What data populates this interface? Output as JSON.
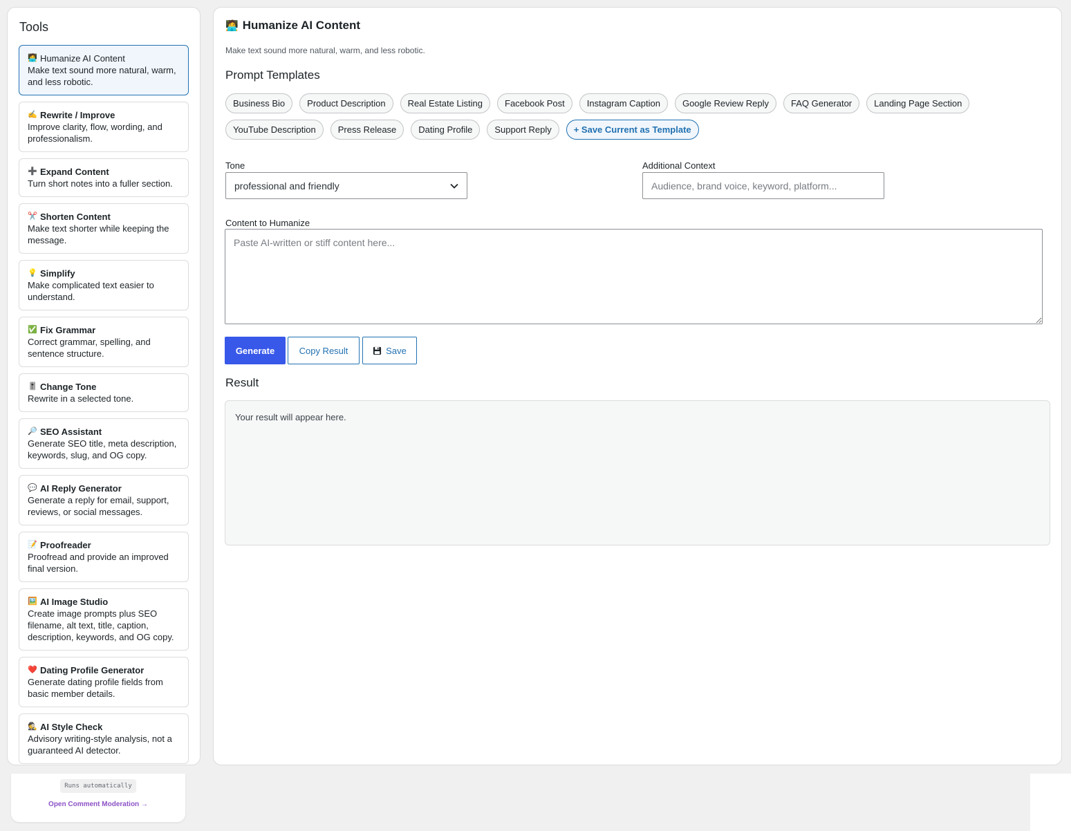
{
  "sidebar": {
    "title": "Tools",
    "tools": [
      {
        "icon": "🧑‍💻",
        "name": "Humanize AI Content",
        "desc": "Make text sound more natural, warm, and less robotic."
      },
      {
        "icon": "✍️",
        "name": "Rewrite / Improve",
        "desc": "Improve clarity, flow, wording, and professionalism."
      },
      {
        "icon": "➕",
        "name": "Expand Content",
        "desc": "Turn short notes into a fuller section."
      },
      {
        "icon": "✂️",
        "name": "Shorten Content",
        "desc": "Make text shorter while keeping the message."
      },
      {
        "icon": "💡",
        "name": "Simplify",
        "desc": "Make complicated text easier to understand."
      },
      {
        "icon": "✅",
        "name": "Fix Grammar",
        "desc": "Correct grammar, spelling, and sentence structure."
      },
      {
        "icon": "🎚️",
        "name": "Change Tone",
        "desc": "Rewrite in a selected tone."
      },
      {
        "icon": "🔎",
        "name": "SEO Assistant",
        "desc": "Generate SEO title, meta description, keywords, slug, and OG copy."
      },
      {
        "icon": "💬",
        "name": "AI Reply Generator",
        "desc": "Generate a reply for email, support, reviews, or social messages."
      },
      {
        "icon": "📝",
        "name": "Proofreader",
        "desc": "Proofread and provide an improved final version."
      },
      {
        "icon": "🖼️",
        "name": "AI Image Studio",
        "desc": "Create image prompts plus SEO filename, alt text, title, caption, description, keywords, and OG copy."
      },
      {
        "icon": "❤️",
        "name": "Dating Profile Generator",
        "desc": "Generate dating profile fields from basic member details."
      },
      {
        "icon": "🕵️",
        "name": "AI Style Check",
        "desc": "Advisory writing-style analysis, not a guaranteed AI detector."
      }
    ]
  },
  "mini_card": {
    "badge": "Runs automatically",
    "link": "Open Comment Moderation →"
  },
  "main": {
    "title_icon": "🧑‍💻",
    "title": "Humanize AI Content",
    "subtitle": "Make text sound more natural, warm, and less robotic.",
    "templates_heading": "Prompt Templates",
    "templates": [
      "Business Bio",
      "Product Description",
      "Real Estate Listing",
      "Facebook Post",
      "Instagram Caption",
      "Google Review Reply",
      "FAQ Generator",
      "Landing Page Section",
      "YouTube Description",
      "Press Release",
      "Dating Profile",
      "Support Reply"
    ],
    "save_template_label": "+ Save Current as Template",
    "tone_label": "Tone",
    "tone_value": "professional and friendly",
    "context_label": "Additional Context",
    "context_placeholder": "Audience, brand voice, keyword, platform...",
    "content_label": "Content to Humanize",
    "content_placeholder": "Paste AI-written or stiff content here...",
    "generate_label": "Generate",
    "copy_label": "Copy Result",
    "save_label": "Save",
    "result_heading": "Result",
    "result_text": "Your result will appear here."
  },
  "colors": {
    "primary": "#3858e9",
    "link": "#2271b1",
    "active_bg": "#f0f6fc",
    "purple_link": "#8c52c6"
  }
}
